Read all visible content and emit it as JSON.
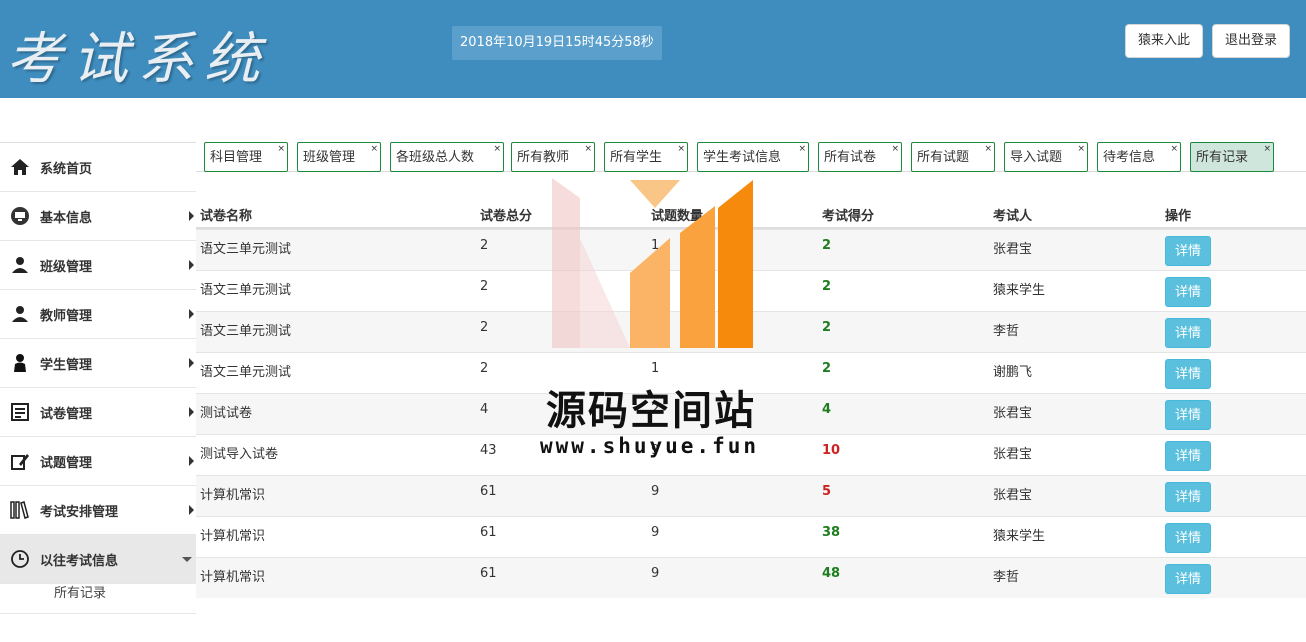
{
  "header": {
    "logo_text": "考试系统",
    "clock_text": "2018年10月19日15时45分58秒",
    "btn_enter": "猿来入此",
    "btn_logout": "退出登录"
  },
  "sidebar": {
    "items": [
      {
        "label": "系统首页",
        "icon": "home-icon"
      },
      {
        "label": "基本信息",
        "icon": "monitor-icon"
      },
      {
        "label": "班级管理",
        "icon": "users-icon"
      },
      {
        "label": "教师管理",
        "icon": "users-icon"
      },
      {
        "label": "学生管理",
        "icon": "user-icon"
      },
      {
        "label": "试卷管理",
        "icon": "list-icon"
      },
      {
        "label": "试题管理",
        "icon": "edit-icon"
      },
      {
        "label": "考试安排管理",
        "icon": "books-icon"
      },
      {
        "label": "以往考试信息",
        "icon": "clock-icon"
      }
    ],
    "sub_item": "所有记录"
  },
  "tabs": [
    "科目管理",
    "班级管理",
    "各班级总人数",
    "所有教师",
    "所有学生",
    "学生考试信息",
    "所有试卷",
    "所有试题",
    "导入试题",
    "待考信息",
    "所有记录"
  ],
  "tab_close": "×",
  "table": {
    "headers": [
      "试卷名称",
      "试卷总分",
      "试题数量",
      "考试得分",
      "考试人",
      "操作"
    ],
    "detail_label": "详情",
    "rows": [
      {
        "name": "语文三单元测试",
        "total": "2",
        "count": "1",
        "score": "2",
        "pass": true,
        "person": "张君宝"
      },
      {
        "name": "语文三单元测试",
        "total": "2",
        "count": "1",
        "score": "2",
        "pass": true,
        "person": "猿来学生"
      },
      {
        "name": "语文三单元测试",
        "total": "2",
        "count": "1",
        "score": "2",
        "pass": true,
        "person": "李哲"
      },
      {
        "name": "语文三单元测试",
        "total": "2",
        "count": "1",
        "score": "2",
        "pass": true,
        "person": "谢鹏飞"
      },
      {
        "name": "测试试卷",
        "total": "4",
        "count": "2",
        "score": "4",
        "pass": true,
        "person": "张君宝"
      },
      {
        "name": "测试导入试卷",
        "total": "43",
        "count": "9",
        "score": "10",
        "pass": false,
        "person": "张君宝"
      },
      {
        "name": "计算机常识",
        "total": "61",
        "count": "9",
        "score": "5",
        "pass": false,
        "person": "张君宝"
      },
      {
        "name": "计算机常识",
        "total": "61",
        "count": "9",
        "score": "38",
        "pass": true,
        "person": "猿来学生"
      },
      {
        "name": "计算机常识",
        "total": "61",
        "count": "9",
        "score": "48",
        "pass": true,
        "person": "李哲"
      }
    ]
  },
  "watermark": {
    "title": "源码空间站",
    "url": "www.shuyue.fun"
  },
  "colors": {
    "header_bg": "#3f8dbf",
    "tab_border": "#1c8a3b",
    "pass": "#1e7d1e",
    "fail": "#cc2222",
    "detail_btn": "#5bc0de"
  }
}
